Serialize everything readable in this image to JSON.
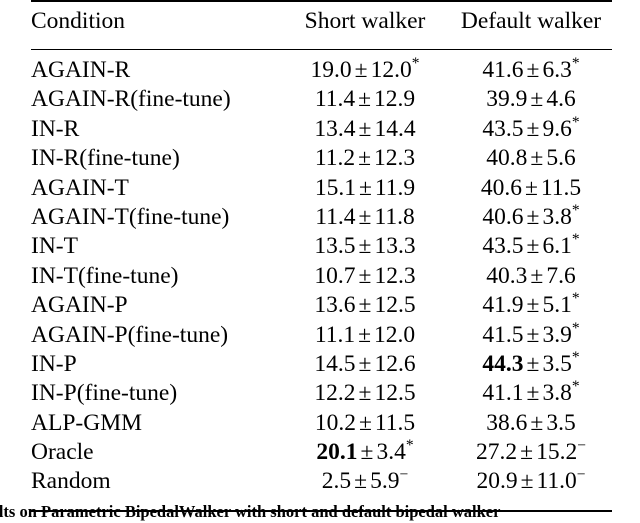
{
  "table": {
    "columns": [
      "Condition",
      "Short walker",
      "Default walker"
    ],
    "rows": [
      {
        "condition": "AGAIN-R",
        "short": {
          "mean": "19.0",
          "sep": "±",
          "std": "12.0",
          "sup": "*",
          "mean_bold": false
        },
        "default": {
          "mean": "41.6",
          "sep": "±",
          "std": "6.3",
          "sup": "*",
          "mean_bold": false
        }
      },
      {
        "condition": "AGAIN-R(fine-tune)",
        "short": {
          "mean": "11.4",
          "sep": "±",
          "std": "12.9",
          "sup": "",
          "mean_bold": false
        },
        "default": {
          "mean": "39.9",
          "sep": "±",
          "std": "4.6",
          "sup": "",
          "mean_bold": false
        }
      },
      {
        "condition": "IN-R",
        "short": {
          "mean": "13.4",
          "sep": "±",
          "std": "14.4",
          "sup": "",
          "mean_bold": false
        },
        "default": {
          "mean": "43.5",
          "sep": "±",
          "std": "9.6",
          "sup": "*",
          "mean_bold": false
        }
      },
      {
        "condition": "IN-R(fine-tune)",
        "short": {
          "mean": "11.2",
          "sep": "±",
          "std": "12.3",
          "sup": "",
          "mean_bold": false
        },
        "default": {
          "mean": "40.8",
          "sep": "±",
          "std": "5.6",
          "sup": "",
          "mean_bold": false
        }
      },
      {
        "condition": "AGAIN-T",
        "short": {
          "mean": "15.1",
          "sep": "±",
          "std": "11.9",
          "sup": "",
          "mean_bold": false
        },
        "default": {
          "mean": "40.6",
          "sep": "±",
          "std": "11.5",
          "sup": "",
          "mean_bold": false
        }
      },
      {
        "condition": "AGAIN-T(fine-tune)",
        "short": {
          "mean": "11.4",
          "sep": "±",
          "std": "11.8",
          "sup": "",
          "mean_bold": false
        },
        "default": {
          "mean": "40.6",
          "sep": "±",
          "std": "3.8",
          "sup": "*",
          "mean_bold": false
        }
      },
      {
        "condition": "IN-T",
        "short": {
          "mean": "13.5",
          "sep": "±",
          "std": "13.3",
          "sup": "",
          "mean_bold": false
        },
        "default": {
          "mean": "43.5",
          "sep": "±",
          "std": "6.1",
          "sup": "*",
          "mean_bold": false
        }
      },
      {
        "condition": "IN-T(fine-tune)",
        "short": {
          "mean": "10.7",
          "sep": "±",
          "std": "12.3",
          "sup": "",
          "mean_bold": false
        },
        "default": {
          "mean": "40.3",
          "sep": "±",
          "std": "7.6",
          "sup": "",
          "mean_bold": false
        }
      },
      {
        "condition": "AGAIN-P",
        "short": {
          "mean": "13.6",
          "sep": "±",
          "std": "12.5",
          "sup": "",
          "mean_bold": false
        },
        "default": {
          "mean": "41.9",
          "sep": "±",
          "std": "5.1",
          "sup": "*",
          "mean_bold": false
        }
      },
      {
        "condition": "AGAIN-P(fine-tune)",
        "short": {
          "mean": "11.1",
          "sep": "±",
          "std": "12.0",
          "sup": "",
          "mean_bold": false
        },
        "default": {
          "mean": "41.5",
          "sep": "±",
          "std": "3.9",
          "sup": "*",
          "mean_bold": false
        }
      },
      {
        "condition": "IN-P",
        "short": {
          "mean": "14.5",
          "sep": "±",
          "std": "12.6",
          "sup": "",
          "mean_bold": false
        },
        "default": {
          "mean": "44.3",
          "sep": "±",
          "std": "3.5",
          "sup": "*",
          "mean_bold": true
        }
      },
      {
        "condition": "IN-P(fine-tune)",
        "short": {
          "mean": "12.2",
          "sep": "±",
          "std": "12.5",
          "sup": "",
          "mean_bold": false
        },
        "default": {
          "mean": "41.1",
          "sep": "±",
          "std": "3.8",
          "sup": "*",
          "mean_bold": false
        }
      },
      {
        "condition": "ALP-GMM",
        "short": {
          "mean": "10.2",
          "sep": "±",
          "std": "11.5",
          "sup": "",
          "mean_bold": false
        },
        "default": {
          "mean": "38.6",
          "sep": "±",
          "std": "3.5",
          "sup": "",
          "mean_bold": false
        }
      },
      {
        "condition": "Oracle",
        "short": {
          "mean": "20.1",
          "sep": "±",
          "std": "3.4",
          "sup": "*",
          "mean_bold": true
        },
        "default": {
          "mean": "27.2",
          "sep": "±",
          "std": "15.2",
          "sup": "−",
          "mean_bold": false
        }
      },
      {
        "condition": "Random",
        "short": {
          "mean": "2.5",
          "sep": "±",
          "std": "5.9",
          "sup": "−",
          "mean_bold": false
        },
        "default": {
          "mean": "20.9",
          "sep": "±",
          "std": "11.0",
          "sup": "−",
          "mean_bold": false
        }
      }
    ]
  },
  "caption": {
    "text": "Results on Parametric BipedalWalker with short and default bipedal walker"
  }
}
